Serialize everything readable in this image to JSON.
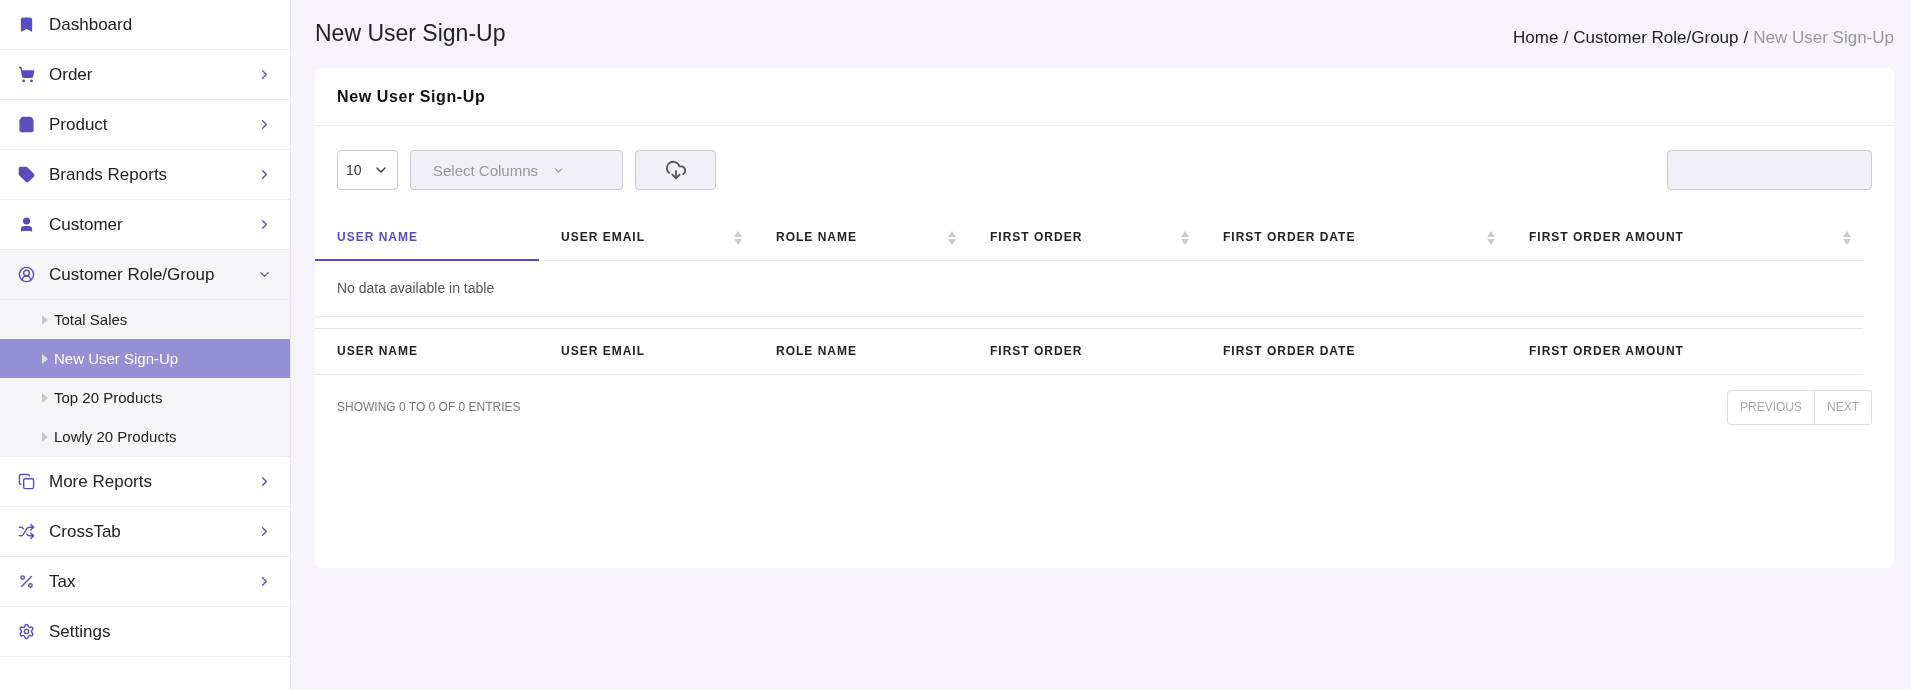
{
  "sidebar": {
    "items": [
      {
        "label": "Dashboard"
      },
      {
        "label": "Order",
        "expanded": false
      },
      {
        "label": "Product",
        "expanded": false
      },
      {
        "label": "Brands Reports",
        "expanded": false
      },
      {
        "label": "Customer",
        "expanded": false
      },
      {
        "label": "Customer Role/Group",
        "expanded": true,
        "children": [
          {
            "label": "Total Sales",
            "selected": false
          },
          {
            "label": "New User Sign-Up",
            "selected": true
          },
          {
            "label": "Top 20 Products",
            "selected": false
          },
          {
            "label": "Lowly 20 Products",
            "selected": false
          }
        ]
      },
      {
        "label": "More Reports",
        "expanded": false
      },
      {
        "label": "CrossTab",
        "expanded": false
      },
      {
        "label": "Tax",
        "expanded": false
      },
      {
        "label": "Settings"
      }
    ]
  },
  "page_title": "New User Sign-Up",
  "breadcrumb": {
    "separator": "/",
    "items": [
      {
        "label": "Home",
        "current": false
      },
      {
        "label": "Customer Role/Group",
        "current": false
      },
      {
        "label": "New User Sign-Up",
        "current": true
      }
    ]
  },
  "card": {
    "title": "New User Sign-Up",
    "page_length": "10",
    "select_columns": {
      "placeholder": "Select Columns"
    },
    "table": {
      "columns": [
        {
          "label": "USER NAME",
          "sorted": true
        },
        {
          "label": "USER EMAIL",
          "sorted": false
        },
        {
          "label": "ROLE NAME",
          "sorted": false
        },
        {
          "label": "FIRST ORDER",
          "sorted": false
        },
        {
          "label": "FIRST ORDER DATE",
          "sorted": false
        },
        {
          "label": "FIRST ORDER AMOUNT",
          "sorted": false
        }
      ],
      "empty_message": "No data available in table",
      "footer_columns": [
        "USER NAME",
        "USER EMAIL",
        "ROLE NAME",
        "FIRST ORDER",
        "FIRST ORDER DATE",
        "FIRST ORDER AMOUNT"
      ]
    },
    "info": "SHOWING 0 TO 0 OF 0 ENTRIES",
    "pagination": [
      {
        "label": "PREVIOUS",
        "disabled": true
      },
      {
        "label": "NEXT",
        "disabled": true
      }
    ]
  }
}
